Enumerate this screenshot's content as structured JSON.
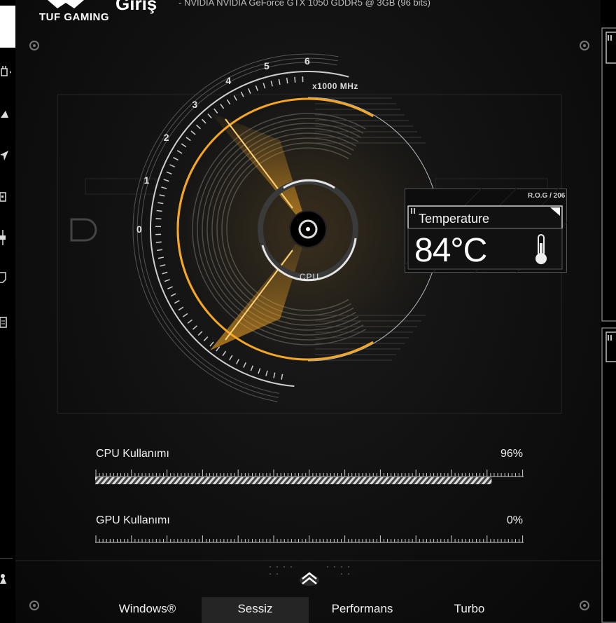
{
  "header": {
    "brand": "TUF GAMING",
    "title": "Giriş",
    "gpu_info": "-   NVIDIA NVIDIA GeForce GTX 1050 GDDR5 @ 3GB (96 bits)"
  },
  "sidebar": {
    "items": [
      {
        "icon": "controller-icon"
      },
      {
        "icon": "droplet-icon"
      },
      {
        "icon": "send-icon"
      },
      {
        "icon": "chip-icon"
      },
      {
        "icon": "slider-icon"
      },
      {
        "icon": "tag-icon"
      },
      {
        "icon": "document-icon"
      },
      {
        "icon": "user-icon"
      }
    ]
  },
  "gauge": {
    "unit_label": "x1000 MHz",
    "tick_labels": [
      "0",
      "1",
      "2",
      "3",
      "4",
      "5",
      "6"
    ],
    "center_label": "CPU",
    "accent_color": "#f5a623"
  },
  "temperature": {
    "tag": "R.O.G / 206",
    "title": "Temperature",
    "value": "84°C"
  },
  "usage": {
    "cpu": {
      "label": "CPU Kullanımı",
      "value": "96%",
      "fraction": 0.96
    },
    "gpu": {
      "label": "GPU Kullanımı",
      "value": "0%",
      "fraction": 0.0
    }
  },
  "modes": {
    "tabs": [
      "Windows®",
      "Sessiz",
      "Performans",
      "Turbo"
    ],
    "active_index": 1
  }
}
